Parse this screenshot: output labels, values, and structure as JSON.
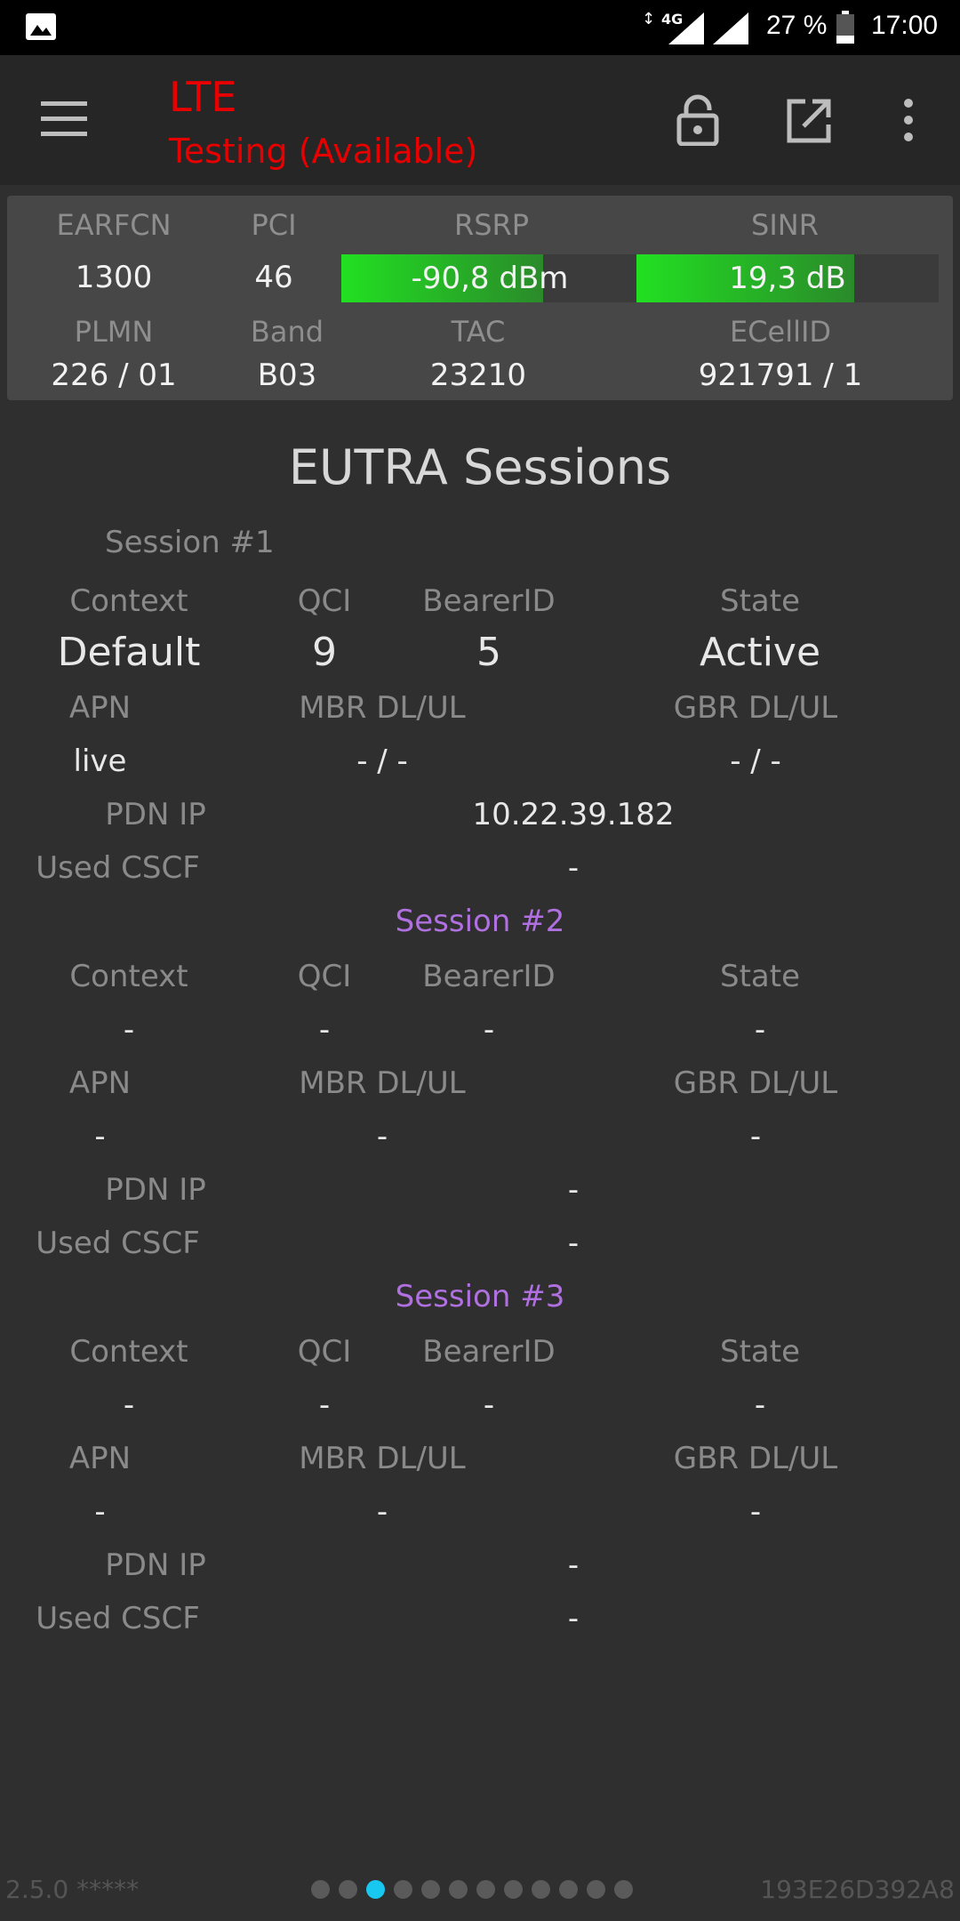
{
  "status_bar": {
    "network_type": "4G",
    "battery": "27 %",
    "time": "17:00"
  },
  "app_bar": {
    "title": "LTE",
    "subtitle": "Testing (Available)",
    "accent_color": "#e60000"
  },
  "cell": {
    "headers_row1": [
      "EARFCN",
      "PCI",
      "RSRP",
      "SINR"
    ],
    "earfcn": "1300",
    "pci": "46",
    "rsrp": {
      "label": "-90,8 dBm",
      "fill_fraction": 0.68
    },
    "sinr": {
      "label": "19,3 dB",
      "fill_fraction": 0.72
    },
    "headers_row2": [
      "PLMN",
      "Band",
      "TAC",
      "ECellID"
    ],
    "plmn": "226 / 01",
    "band": "B03",
    "tac": "23210",
    "ecellid": "921791 / 1"
  },
  "sessions_title": "EUTRA Sessions",
  "labels": {
    "context": "Context",
    "qci": "QCI",
    "bearer_id": "BearerID",
    "state": "State",
    "apn": "APN",
    "mbr": "MBR DL/UL",
    "gbr": "GBR DL/UL",
    "pdn_ip": "PDN IP",
    "used_cscf": "Used CSCF"
  },
  "sessions": [
    {
      "label": "Session #1",
      "label_color": "#8a8a8a",
      "context": "Default",
      "qci": "9",
      "bearer_id": "5",
      "state": "Active",
      "apn": "live",
      "mbr": "- / -",
      "gbr": "- / -",
      "pdn_ip": "10.22.39.182",
      "used_cscf": "-"
    },
    {
      "label": "Session #2",
      "label_color": "#b070e0",
      "context": "-",
      "qci": "-",
      "bearer_id": "-",
      "state": "-",
      "apn": "-",
      "mbr": "-",
      "gbr": "-",
      "pdn_ip": "-",
      "used_cscf": "-"
    },
    {
      "label": "Session #3",
      "label_color": "#b070e0",
      "context": "-",
      "qci": "-",
      "bearer_id": "-",
      "state": "-",
      "apn": "-",
      "mbr": "-",
      "gbr": "-",
      "pdn_ip": "-",
      "used_cscf": "-"
    }
  ],
  "footer": {
    "version": "2.5.0 *****",
    "device_id": "193E26D392A8",
    "page_count": 12,
    "active_page": 3,
    "active_dot_color": "#19c8f0"
  }
}
